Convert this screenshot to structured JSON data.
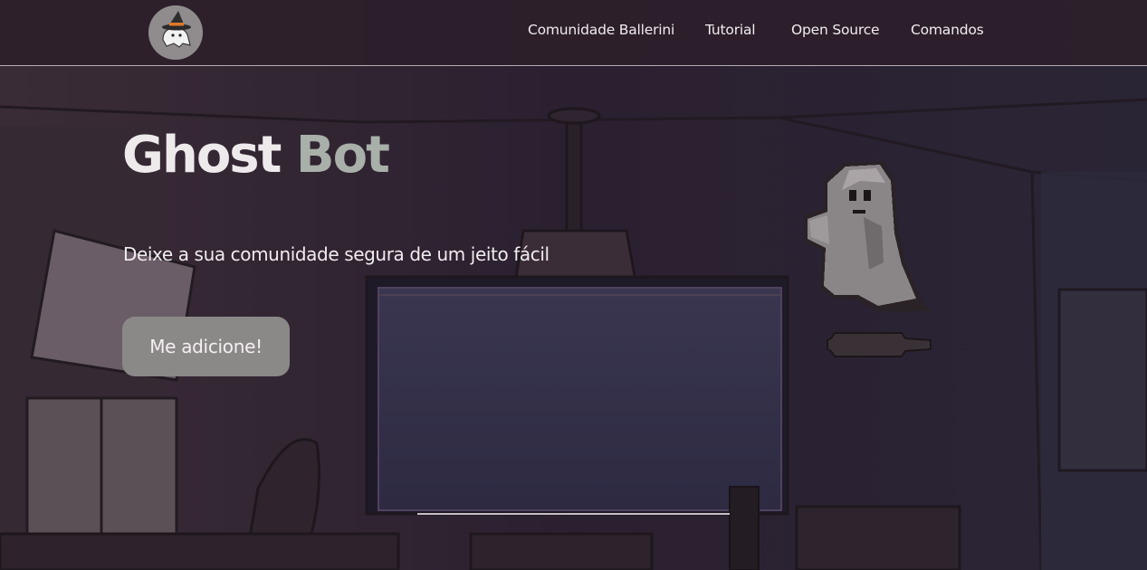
{
  "navbar": {
    "logo_icon": "witch-hat-ghost-logo-icon",
    "links": [
      {
        "label": "Comunidade Ballerini"
      },
      {
        "label": "Tutorial"
      },
      {
        "label": "Open Source"
      },
      {
        "label": "Comandos"
      }
    ]
  },
  "hero": {
    "title_part1": "Ghost",
    "title_part2": "Bot",
    "subtitle": "Deixe a sua comunidade segura de um jeito fácil",
    "cta_label": "Me adicione!",
    "mascot_icon": "pixel-ghost-icon"
  },
  "colors": {
    "background": "#2a2029",
    "navbar": "#2c202a",
    "title_primary": "#eeeaec",
    "title_accent": "#a8b0a9",
    "button": "#8b8888",
    "text": "#f1ecef"
  }
}
